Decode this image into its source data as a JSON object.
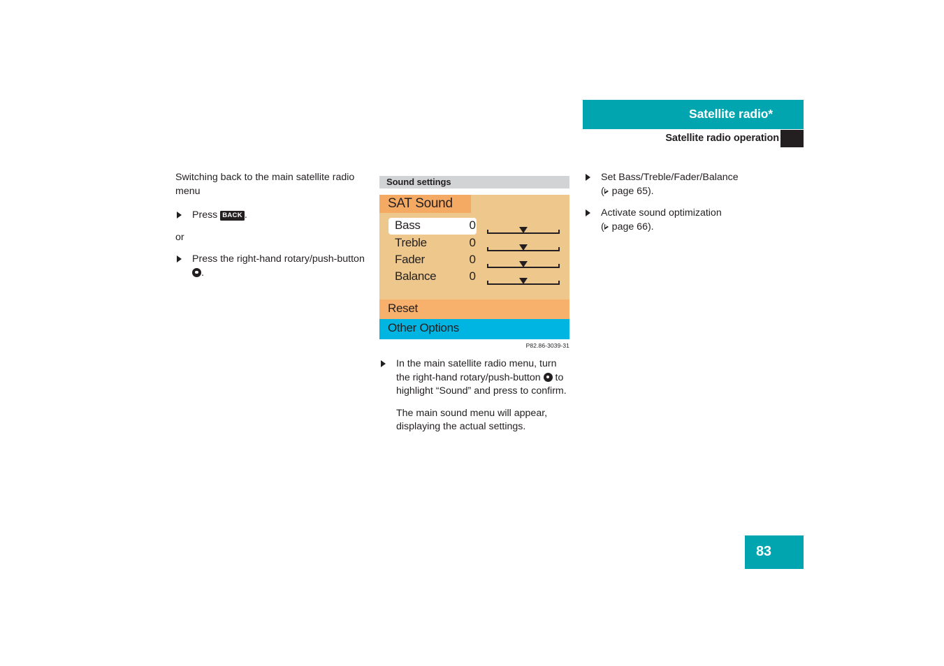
{
  "header": {
    "title": "Satellite radio*",
    "subtitle": "Satellite radio operation"
  },
  "left_column": {
    "heading": "Switching back to the main satellite radio menu",
    "step1_prefix": "Press ",
    "step1_key": "BACK",
    "step1_suffix": ".",
    "or_label": "or",
    "step2_prefix": "Press the right-hand rotary/push-button ",
    "step2_suffix": "."
  },
  "figure": {
    "caption_bar_label": "Sound settings",
    "image_code": "P82.86-3039-31",
    "screen": {
      "title": "SAT Sound",
      "rows": [
        {
          "label": "Bass",
          "value": "0",
          "highlighted": true
        },
        {
          "label": "Treble",
          "value": "0",
          "highlighted": false
        },
        {
          "label": "Fader",
          "value": "0",
          "highlighted": false
        },
        {
          "label": "Balance",
          "value": "0",
          "highlighted": false
        }
      ],
      "reset_label": "Reset",
      "other_options_label": "Other Options"
    }
  },
  "middle_column": {
    "step1_part1": "In the main satellite radio menu, turn the right-hand rotary/push-button ",
    "step1_part2": " to highlight “Sound” and press to confirm.",
    "paragraph": "The main sound menu will appear, displaying the actual settings."
  },
  "right_column": {
    "item1_label": "Set Bass/Treble/Fader/Balance",
    "item1_ref_open": "(",
    "item1_ref_text": " page 65).",
    "item2_label": "Activate sound optimization",
    "item2_ref_open": "(",
    "item2_ref_text": " page 66)."
  },
  "footer": {
    "page_number": "83"
  },
  "colors": {
    "teal": "#00a5b0",
    "dark": "#231f20",
    "screen_bg": "#edc78b",
    "screen_title_bg": "#f5aa63",
    "reset_bg": "#f8b16d",
    "other_options_bg": "#00b5e2",
    "caption_bar_bg": "#d2d3d5"
  }
}
